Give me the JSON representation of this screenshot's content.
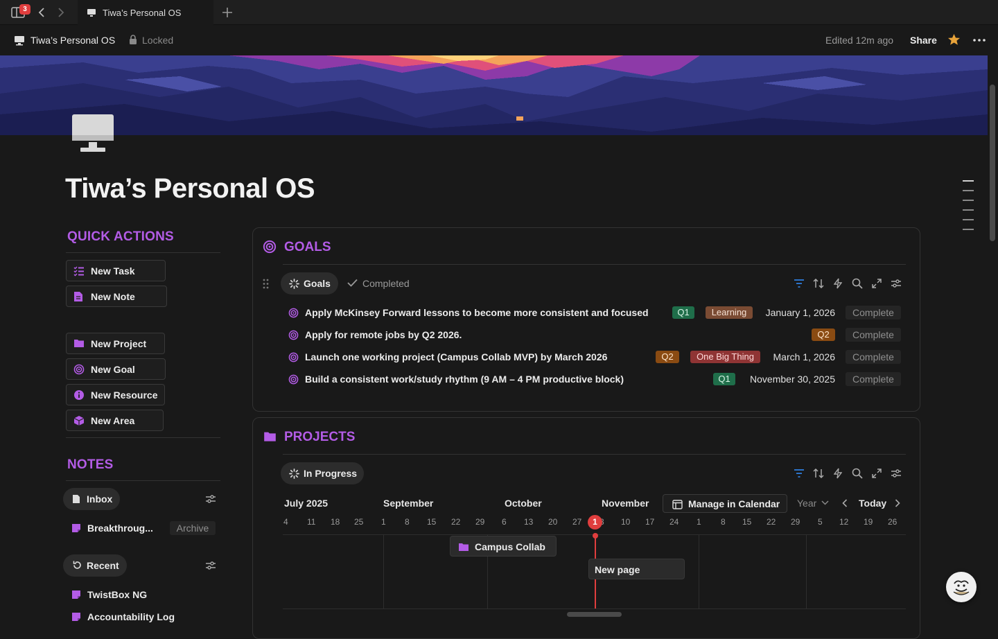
{
  "window": {
    "sidebar_badge": "3",
    "tab_title": "Tiwa’s Personal OS"
  },
  "topbar": {
    "breadcrumb_title": "Tiwa’s Personal OS",
    "locked_label": "Locked",
    "edited": "Edited 12m ago",
    "share_label": "Share"
  },
  "page": {
    "title": "Tiwa’s Personal OS"
  },
  "quick_actions": {
    "heading": "QUICK ACTIONS",
    "buttons": [
      {
        "label": "New Task",
        "icon": "checklist-icon"
      },
      {
        "label": "New Note",
        "icon": "note-icon"
      },
      {
        "label": "New Project",
        "icon": "folder-icon"
      },
      {
        "label": "New Goal",
        "icon": "target-icon"
      },
      {
        "label": "New Resource",
        "icon": "info-icon"
      },
      {
        "label": "New Area",
        "icon": "cube-icon"
      }
    ]
  },
  "notes": {
    "heading": "NOTES",
    "inbox_label": "Inbox",
    "inbox_items": [
      {
        "title": "Breakthroug...",
        "tag": "Archive"
      }
    ],
    "recent_label": "Recent",
    "recent_items": [
      {
        "title": "TwistBox NG"
      },
      {
        "title": "Accountability Log"
      }
    ]
  },
  "goals": {
    "heading": "GOALS",
    "views": [
      "Goals",
      "Completed"
    ],
    "rows": [
      {
        "name": "Apply McKinsey Forward lessons to become more consistent and focused",
        "tags": [
          "Q1",
          "Learning"
        ],
        "date": "January 1, 2026",
        "status": "Complete"
      },
      {
        "name": "Apply for remote jobs by Q2 2026.",
        "tags": [
          "Q2"
        ],
        "date": "",
        "status": "Complete"
      },
      {
        "name": "Launch one working project (Campus Collab MVP) by March 2026",
        "tags": [
          "Q2",
          "One Big Thing"
        ],
        "date": "March 1, 2026",
        "status": "Complete"
      },
      {
        "name": "Build a consistent work/study rhythm (9 AM – 4 PM productive block)",
        "tags": [
          "Q1"
        ],
        "date": "November 30, 2025",
        "status": "Complete"
      }
    ]
  },
  "projects": {
    "heading": "PROJECTS",
    "view": "In Progress",
    "manage_label": "Manage in Calendar",
    "range_label": "Year",
    "today_label": "Today",
    "today_marker": "1",
    "months": [
      "July 2025",
      "September",
      "October",
      "November"
    ],
    "days": [
      "4",
      "11",
      "18",
      "25",
      "1",
      "8",
      "15",
      "22",
      "29",
      "6",
      "13",
      "20",
      "27",
      "3",
      "10",
      "17",
      "24",
      "1",
      "8",
      "15",
      "22",
      "29",
      "5",
      "12",
      "19",
      "26"
    ],
    "cards": [
      {
        "label": "Campus Collab"
      },
      {
        "label": "New page"
      }
    ]
  },
  "colors": {
    "accent_purple": "#b35ce6",
    "today_red": "#e03e3e",
    "filter_blue": "#2f7fe0",
    "star": "#e8a33a"
  }
}
